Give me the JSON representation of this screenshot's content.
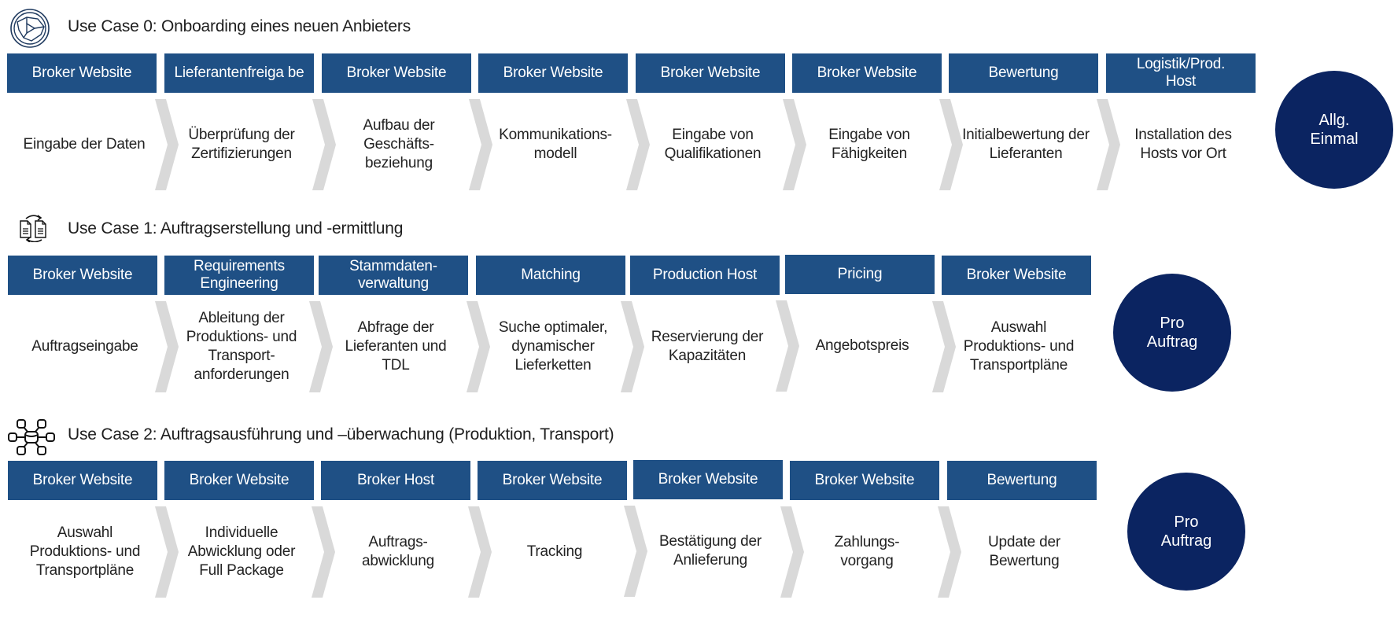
{
  "colors": {
    "step_header_bg": "#1F5085",
    "frequency_circle_bg": "#0B2461",
    "chevron": "#D9D9D9",
    "text": "#222222"
  },
  "use_cases": [
    {
      "icon": "steering-wheel-network-icon",
      "title": "Use Case 0: Onboarding eines neuen Anbieters",
      "frequency": "Allg.\nEinmal",
      "steps": [
        {
          "system": "Broker Website",
          "activity": "Eingabe der Daten"
        },
        {
          "system": "Lieferantenfreiga be",
          "activity": "Überprüfung der Zertifizierungen"
        },
        {
          "system": "Broker Website",
          "activity": "Aufbau der Geschäfts- beziehung"
        },
        {
          "system": "Broker Website",
          "activity": "Kommunikations- modell"
        },
        {
          "system": "Broker Website",
          "activity": "Eingabe von Qualifikationen"
        },
        {
          "system": "Broker Website",
          "activity": "Eingabe von Fähigkeiten"
        },
        {
          "system": "Bewertung",
          "activity": "Initialbewertung der Lieferanten"
        },
        {
          "system": "Logistik/Prod. Host",
          "activity": "Installation des Hosts vor Ort"
        }
      ]
    },
    {
      "icon": "document-exchange-icon",
      "title": "Use Case 1: Auftragserstellung und -ermittlung",
      "frequency": "Pro\nAuftrag",
      "steps": [
        {
          "system": "Broker Website",
          "activity": "Auftragseingabe"
        },
        {
          "system": "Requirements Engineering",
          "activity": "Ableitung der Produktions- und Transport- anforderungen"
        },
        {
          "system": "Stammdaten- verwaltung",
          "activity": "Abfrage der Lieferanten und TDL"
        },
        {
          "system": "Matching",
          "activity": "Suche optimaler, dynamischer Lieferketten"
        },
        {
          "system": "Production Host",
          "activity": "Reservierung der Kapazitäten"
        },
        {
          "system": "Pricing",
          "activity": "Angebotspreis"
        },
        {
          "system": "Broker Website",
          "activity": "Auswahl Produktions- und Transportpläne"
        }
      ]
    },
    {
      "icon": "database-network-icon",
      "title": "Use Case 2: Auftragsausführung und –überwachung (Produktion, Transport)",
      "frequency": "Pro\nAuftrag",
      "steps": [
        {
          "system": "Broker Website",
          "activity": "Auswahl Produktions- und Transportpläne"
        },
        {
          "system": "Broker Website",
          "activity": "Individuelle Abwicklung oder Full Package"
        },
        {
          "system": "Broker Host",
          "activity": "Auftrags- abwicklung"
        },
        {
          "system": "Broker Website",
          "activity": "Tracking"
        },
        {
          "system": "Broker Website",
          "activity": "Bestätigung der Anlieferung"
        },
        {
          "system": "Broker Website",
          "activity": "Zahlungs- vorgang"
        },
        {
          "system": "Bewertung",
          "activity": "Update der Bewertung"
        }
      ]
    }
  ]
}
